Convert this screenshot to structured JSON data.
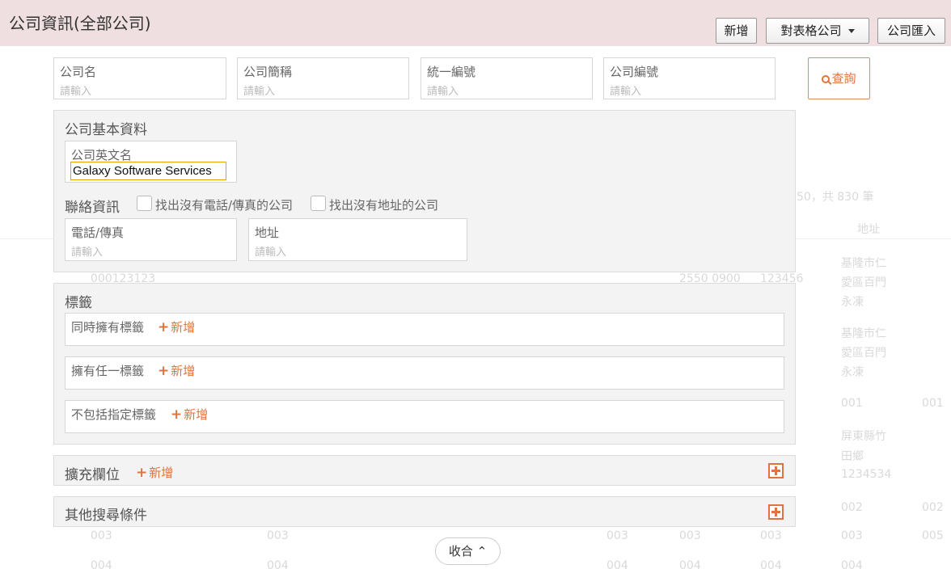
{
  "header": {
    "title": "公司資訊(全部公司)",
    "buttons": {
      "add": "新增",
      "table_company": "對表格公司",
      "import": "公司匯入"
    }
  },
  "search": {
    "fields": [
      {
        "label": "公司名",
        "placeholder": "請輸入"
      },
      {
        "label": "公司簡稱",
        "placeholder": "請輸入"
      },
      {
        "label": "統一編號",
        "placeholder": "請輸入"
      },
      {
        "label": "公司編號",
        "placeholder": "請輸入"
      }
    ],
    "query_button": "查詢"
  },
  "basic": {
    "title": "公司基本資料",
    "english_name_label": "公司英文名",
    "english_name_value": "Galaxy Software Services"
  },
  "contact": {
    "title": "聯絡資訊",
    "chk_no_phone": "找出沒有電話/傳真的公司",
    "chk_no_address": "找出沒有地址的公司",
    "phone_label": "電話/傳真",
    "phone_placeholder": "請輸入",
    "address_label": "地址",
    "address_placeholder": "請輸入"
  },
  "tags": {
    "title": "標籤",
    "groups": [
      {
        "label": "同時擁有標籤",
        "add": "新增"
      },
      {
        "label": "擁有任一標籤",
        "add": "新增"
      },
      {
        "label": "不包括指定標籤",
        "add": "新增"
      }
    ]
  },
  "extended": {
    "title": "擴充欄位",
    "add": "新增"
  },
  "other": {
    "title": "其他搜尋條件"
  },
  "collapse": {
    "label": "收合"
  },
  "background": {
    "paging": "50，共 830 筆",
    "col_address": "地址",
    "cells": [
      "000123123",
      "2550 0900",
      "123456",
      "基隆市仁",
      "愛區百門",
      "永凍",
      "基隆市仁",
      "愛區百門",
      "永凍",
      "001",
      "001",
      "屏東縣竹",
      "田鄉",
      "1234534",
      "002",
      "002",
      "003",
      "003",
      "003",
      "003",
      "003",
      "003",
      "005",
      "004",
      "004",
      "004",
      "004",
      "004",
      "004"
    ]
  },
  "colors": {
    "accent": "#e0733f",
    "header_bg": "#efdfe0",
    "panel_bg": "#f3f3f3"
  }
}
